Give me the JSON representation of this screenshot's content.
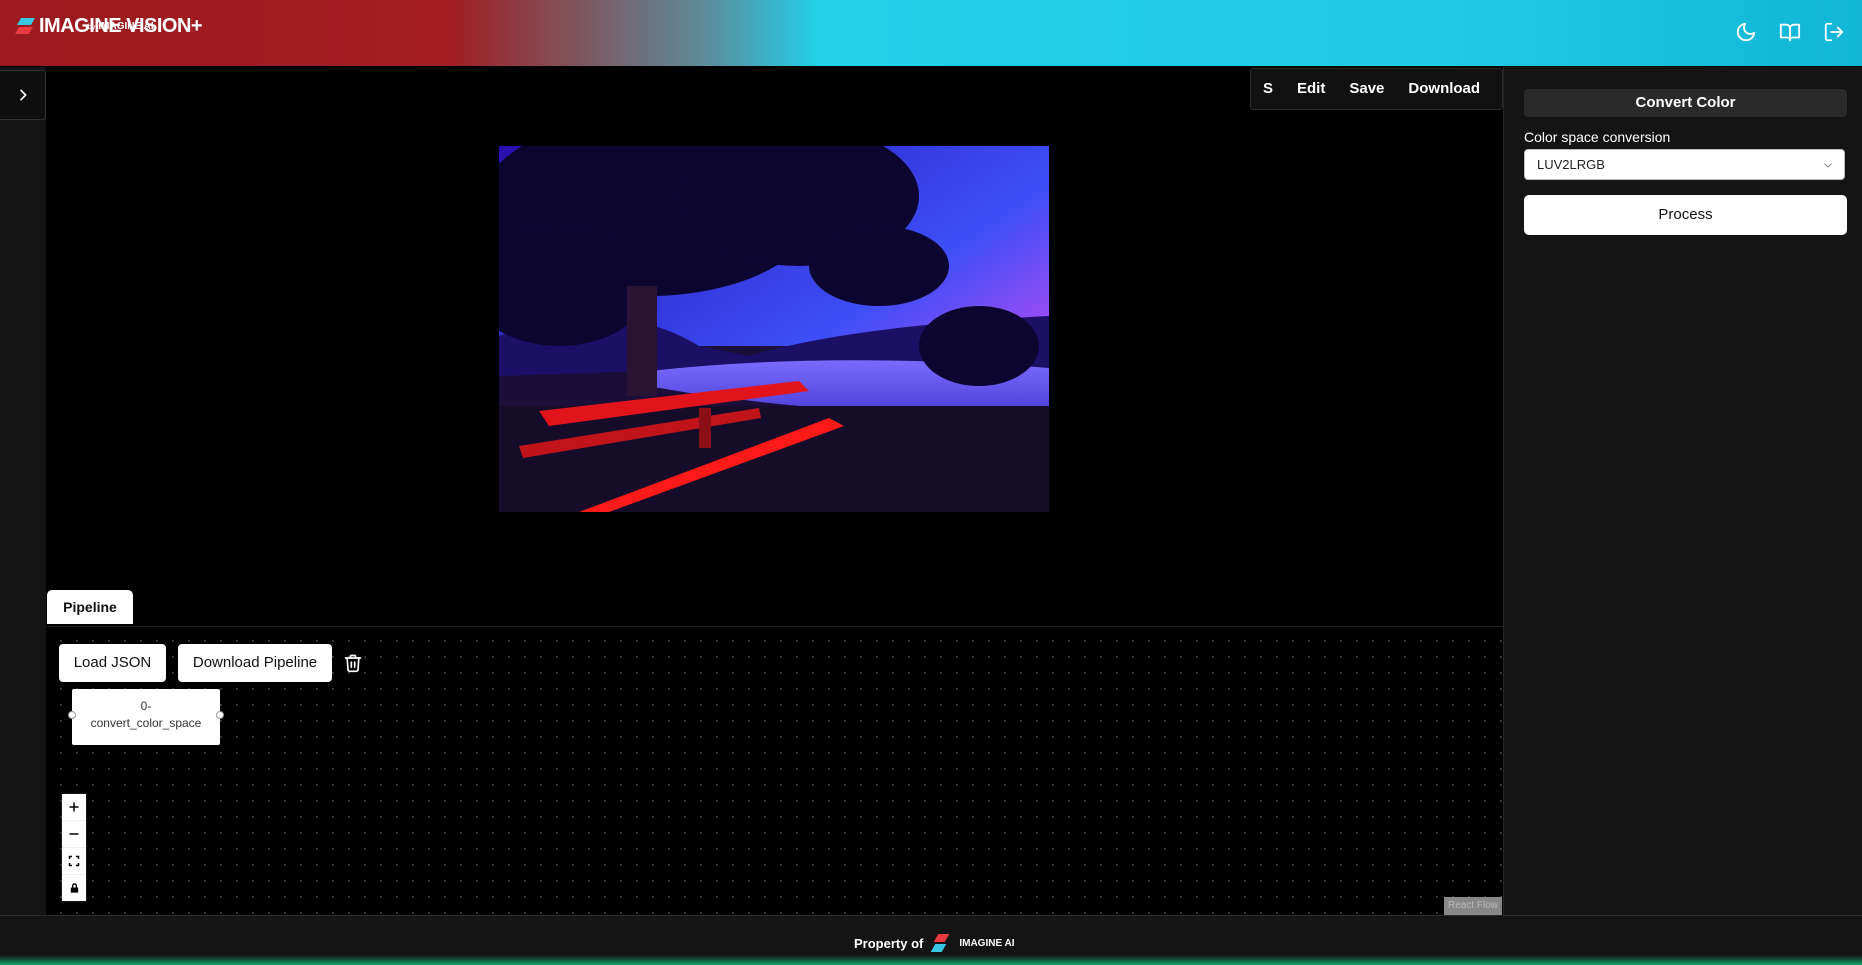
{
  "header": {
    "brand": "IMAGINE VISION+",
    "brand_by": "by",
    "brand_sub": "IMAGINE AI",
    "icons": [
      "moon-icon",
      "book-icon",
      "logout-icon"
    ]
  },
  "image_toolbar": {
    "items": [
      "S",
      "Edit",
      "Save",
      "Download"
    ]
  },
  "right_panel": {
    "title": "Convert Color",
    "field_label": "Color space conversion",
    "select_value": "LUV2LRGB",
    "process_label": "Process"
  },
  "pipeline": {
    "tab_label": "Pipeline",
    "load_json": "Load JSON",
    "download_pipeline": "Download Pipeline",
    "node_label_1": "0-",
    "node_label_2": "convert_color_space",
    "attribution": "React Flow"
  },
  "footer": {
    "text": "Property of",
    "logo_text": "IMAGINE AI"
  },
  "colors": {
    "header_red": "#a11d20",
    "header_cyan": "#1fc9e6",
    "panel_bg": "#141414"
  }
}
